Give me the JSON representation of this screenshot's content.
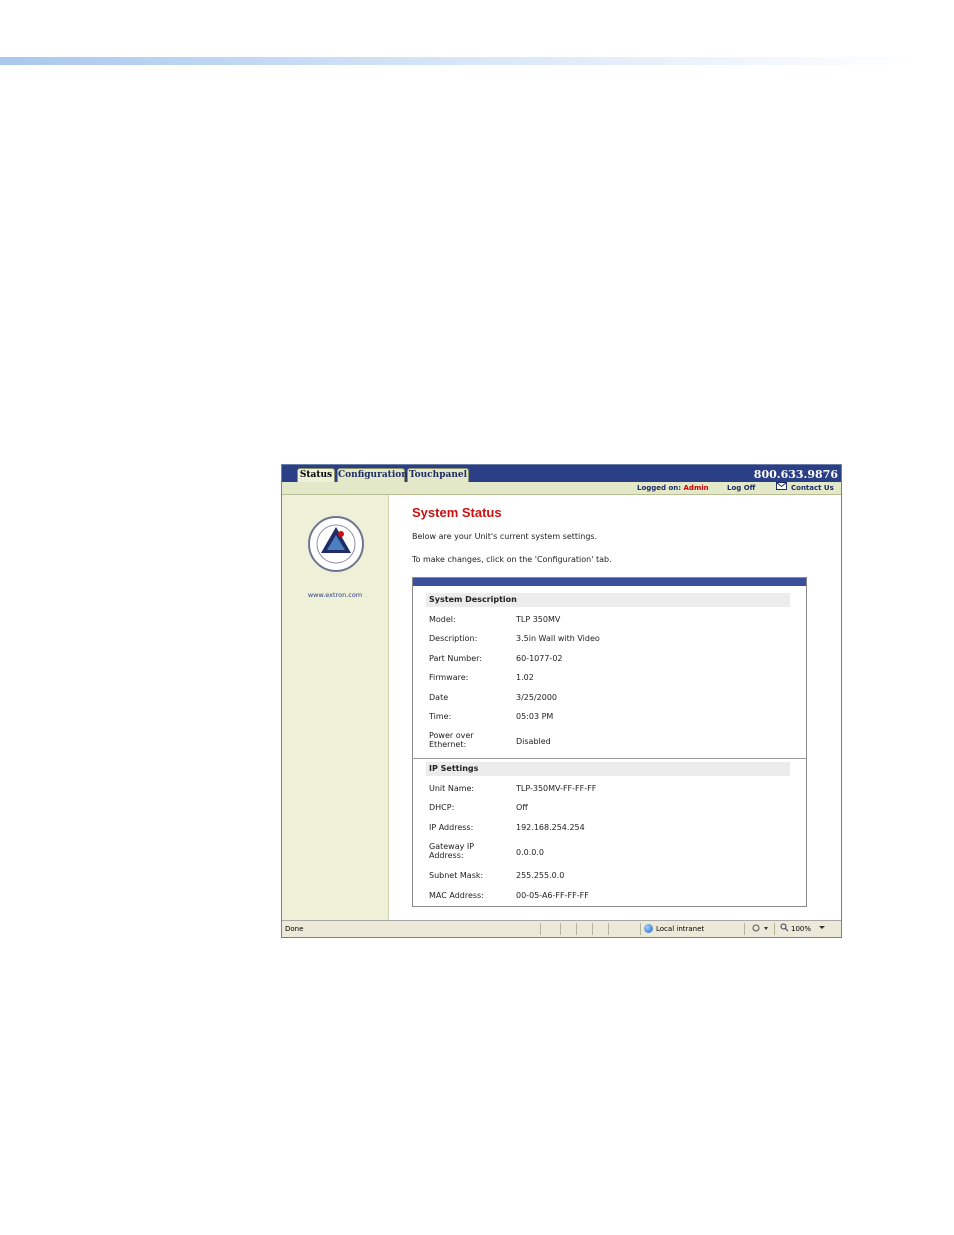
{
  "browser": {
    "tabs": [
      {
        "label": "Status",
        "active": true
      },
      {
        "label": "Configuration",
        "active": false
      },
      {
        "label": "Touchpanel",
        "active": false
      }
    ],
    "phone": "800.633.9876",
    "logged_on_label": "Logged on:",
    "logged_on_user": "Admin",
    "log_off": "Log Off",
    "contact_us": "Contact Us",
    "status_done": "Done",
    "zone": "Local intranet",
    "zoom": "100%"
  },
  "sidebar": {
    "logo_icon": "extron-s3-logo-icon",
    "url": "www.extron.com"
  },
  "main": {
    "title": "System Status",
    "intro_1": "Below are your Unit's current system settings.",
    "intro_2": "To make changes, click on the 'Configuration' tab."
  },
  "system_description": {
    "heading": "System Description",
    "rows": [
      {
        "label": "Model:",
        "value": "TLP 350MV"
      },
      {
        "label": "Description:",
        "value": "3.5in Wall with Video"
      },
      {
        "label": "Part Number:",
        "value": "60-1077-02"
      },
      {
        "label": "Firmware:",
        "value": "1.02"
      },
      {
        "label": "Date",
        "value": "3/25/2000"
      },
      {
        "label": "Time:",
        "value": "05:03 PM"
      },
      {
        "label": "Power over Ethernet:",
        "value": "Disabled"
      }
    ]
  },
  "ip_settings": {
    "heading": "IP Settings",
    "rows": [
      {
        "label": "Unit Name:",
        "value": "TLP-350MV-FF-FF-FF"
      },
      {
        "label": "DHCP:",
        "value": "Off"
      },
      {
        "label": "IP Address:",
        "value": "192.168.254.254"
      },
      {
        "label": "Gateway IP Address:",
        "value": "0.0.0.0"
      },
      {
        "label": "Subnet Mask:",
        "value": "255.255.0.0"
      },
      {
        "label": "MAC Address:",
        "value": "00-05-A6-FF-FF-FF"
      }
    ]
  },
  "colors": {
    "tab_bar": "#2a3f86",
    "title_red": "#cc1111",
    "sidebar_bg": "#eef0d8"
  }
}
